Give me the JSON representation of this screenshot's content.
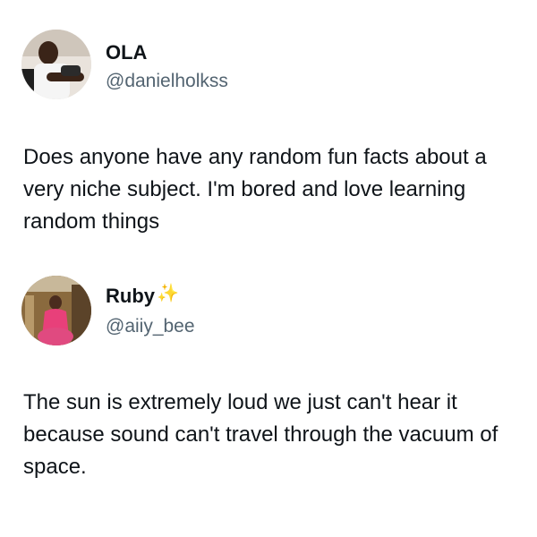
{
  "posts": [
    {
      "author": {
        "display_name": "OLA",
        "handle": "@danielholkss",
        "avatar": "profile-photo"
      },
      "text": "Does anyone have any random fun facts about a very niche subject. I'm bored and love learning random things"
    },
    {
      "author": {
        "display_name": "Ruby",
        "name_emoji": "✨",
        "handle": "@aiiy_bee",
        "avatar": "profile-photo"
      },
      "text": "The sun is extremely loud we just can't hear it because sound can't travel through the vacuum of space."
    }
  ]
}
